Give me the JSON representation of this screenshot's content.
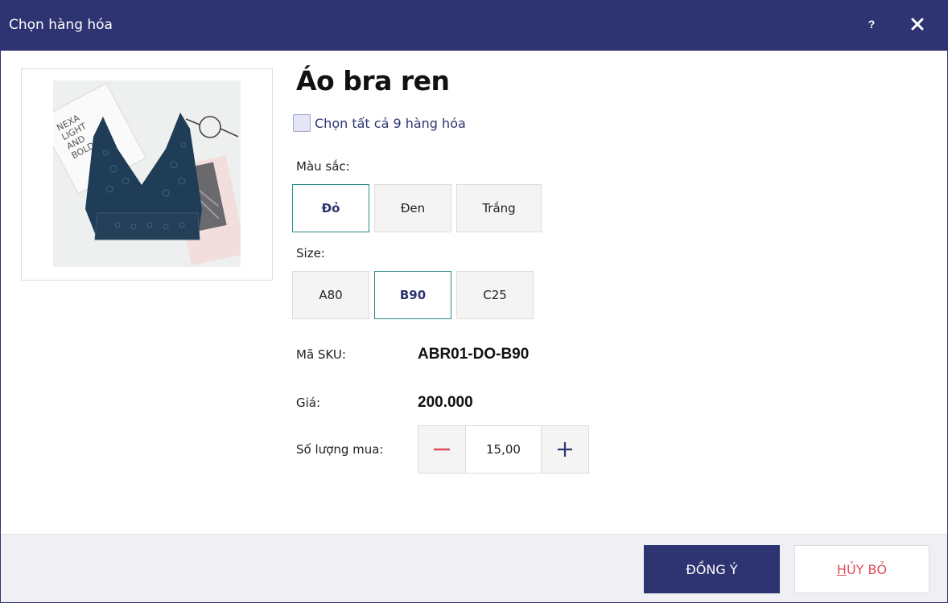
{
  "window": {
    "title": "Chọn hàng hóa",
    "help_label": "?"
  },
  "product": {
    "name": "Áo bra ren",
    "image_icon": "product-photo-lace-bra",
    "select_all_label": "Chọn tất cả 9 hàng hóa",
    "select_all_checked": false
  },
  "color": {
    "label": "Màu sắc:",
    "options": [
      "Đỏ",
      "Đen",
      "Trắng"
    ],
    "selected": "Đỏ"
  },
  "size": {
    "label": "Size:",
    "options": [
      "A80",
      "B90",
      "C25"
    ],
    "selected": "B90"
  },
  "sku": {
    "label": "Mã SKU:",
    "value": "ABR01-DO-B90"
  },
  "price": {
    "label": "Giá:",
    "value": "200.000"
  },
  "quantity": {
    "label": "Số lượng mua:",
    "value": "15,00",
    "minus_icon": "minus-icon",
    "plus_icon": "plus-icon"
  },
  "footer": {
    "ok_label": "ĐỒNG Ý",
    "cancel_first": "H",
    "cancel_rest": "ỦY BỎ"
  },
  "colors": {
    "primary": "#2e3472",
    "selected_border": "#2a8a8a",
    "minus": "#e04b5a",
    "cancel_text": "#e04b5a"
  }
}
